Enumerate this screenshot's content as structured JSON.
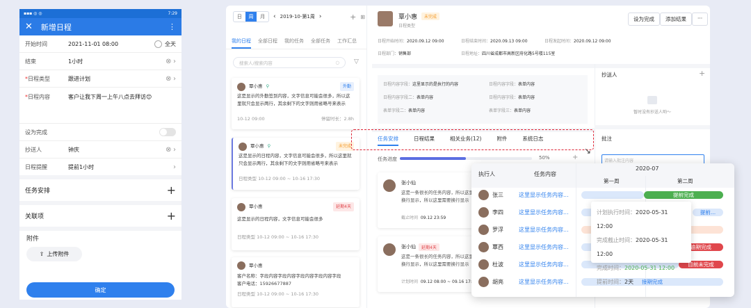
{
  "phone": {
    "status_time": "7:29",
    "title": "新增日程",
    "rows": [
      {
        "label": "开始时间",
        "value": "2021-11-01      08:00",
        "extra": "全天"
      },
      {
        "label": "结束",
        "value": "1小时"
      },
      {
        "label": "日程类型",
        "value": "跟进计划",
        "required": true
      },
      {
        "label": "日程内容",
        "value": "客户让我下周一上午八点去拜访😊",
        "required": true
      }
    ],
    "complete_label": "设为完成",
    "cc_label": "抄送人",
    "cc_value": "钟庆",
    "remind_label": "日程提醒",
    "remind_value": "提前1小时",
    "task_section": "任务安排",
    "related_section": "关联项",
    "attach_label": "附件",
    "upload_label": "上传附件",
    "ok_label": "确定"
  },
  "desk": {
    "view_segments": [
      "日",
      "周",
      "月"
    ],
    "week_label": "2019-10-第1周",
    "left_tabs": [
      "我的日程",
      "全部日程",
      "我的任务",
      "全部任务",
      "工作汇总"
    ],
    "search_placeholder": "搜索人/搜索内容",
    "cards": [
      {
        "name": "覃小惠",
        "tag": "外勤",
        "text": "这是显示的外勤签到内容，文字信息可能会很多，所以这里就只会显示两行，其余剩下的文字则用省略号来表示",
        "time": "10-12 09:00",
        "extra": "停留时长：2.8h"
      },
      {
        "name": "覃小惠",
        "tag": "未完成",
        "text": "这是显示的日程内容，文字信息可能会很多，所以这里就只会显示两行，其余剩下的文字则用省略号来表示",
        "time": "日程类型   10-12 09:00 ~ 10-16 17:30"
      },
      {
        "name": "覃小惠",
        "tag": "延期4天",
        "text": "这是显示的日程内容，文字信息可能会很多",
        "time": "日程类型   10-12 09:00 ~ 10-16 17:30"
      },
      {
        "name": "覃小惠",
        "tag": "",
        "text": "客户名称：字段内容字段内容字段内容字段内容字段",
        "phone": "客户电话：15926677887",
        "time": "日程类型   10-12 09:00 ~ 10-16 17:30"
      }
    ],
    "header": {
      "name": "覃小惠",
      "status": "未完成",
      "type": "日程类型",
      "btn_done": "设为完成",
      "btn_result": "添加结果",
      "btn_more": "···",
      "start_label": "日程开始时间：",
      "start": "2020.09.12 09:00",
      "end_label": "日程结束时间：",
      "end": "2020.09.13 09:00",
      "create_label": "日程发起时间：",
      "create": "2020.09.12 09:00",
      "dept_label": "日程部门：",
      "dept": "销售部",
      "addr_label": "日程地址：",
      "addr": "四川省成都市高新区府化路5号楼115室"
    },
    "fields": [
      {
        "label": "日程内容字段：",
        "value": "这里显示的是执行的内容"
      },
      {
        "label": "日程内容字段：",
        "value": "表单内容"
      },
      {
        "label": "日程内容字段二：",
        "value": "表单内容"
      },
      {
        "label": "日程内容字段：",
        "value": "表单内容"
      },
      {
        "label": "表单字段二：",
        "value": "表单内容"
      },
      {
        "label": "表单字段三：",
        "value": "表单内容"
      }
    ],
    "cc_title": "抄送人",
    "cc_empty": "暂时没有抄送人哟～",
    "comment_title": "批注",
    "comment_placeholder": "请输入批注内容",
    "detail_tabs": [
      "任务安排",
      "日程结果",
      "相关业务(12)",
      "附件",
      "系统日志"
    ],
    "progress_label": "任务进度",
    "progress_pct": 50,
    "progress_text": "50%",
    "tasks": [
      {
        "name": "张小仙",
        "text": "这是一条很长的任务内容，所以这里需要换行显示，所以这里需要换行显示",
        "deadline_label": "截止时间",
        "deadline": "09.12 23:59"
      },
      {
        "name": "张小仙",
        "tag": "延期4天",
        "text": "这是一条很长的任务内容，所以这里需要换行显示，所以这里需要换行显示",
        "plan_label": "计划时间",
        "plan": "09.12 08:00 ~ 09.16 17:30"
      }
    ]
  },
  "gantt": {
    "col_exec": "执行人",
    "col_task": "任务内容",
    "month": "2020-07",
    "weeks": [
      "第一周",
      "第二周"
    ],
    "rows": [
      {
        "name": "张三",
        "task": "这里显示任务内容..."
      },
      {
        "name": "李四",
        "task": "这里显示任务内容..."
      },
      {
        "name": "罗浮",
        "task": "这里显示任务内容..."
      },
      {
        "name": "覃西",
        "task": "这里显示任务内容..."
      },
      {
        "name": "杜波",
        "task": "这里显示任务内容..."
      },
      {
        "name": "胡亮",
        "task": "这里显示任务内容..."
      }
    ],
    "bar_early": "提前完成",
    "bar_early2": "提前...",
    "bar_overdue": "逾期完成",
    "bar_late": "目前未完成",
    "bar_delay": "接期完成",
    "colors": {
      "green": "#4caf50",
      "red": "#e0474c",
      "blue": "#dbe8fb",
      "orange": "#fde3d6"
    },
    "tip": {
      "plan_label": "计划执行时间：",
      "plan": "2020-05-31 12:00",
      "deadline_label": "完成截止时间：",
      "deadline": "2020-05-31 12:00",
      "done_label": "完成时间：",
      "done": "2020-05-31 12:00",
      "early_label": "提前时间：",
      "early": "2天"
    }
  }
}
